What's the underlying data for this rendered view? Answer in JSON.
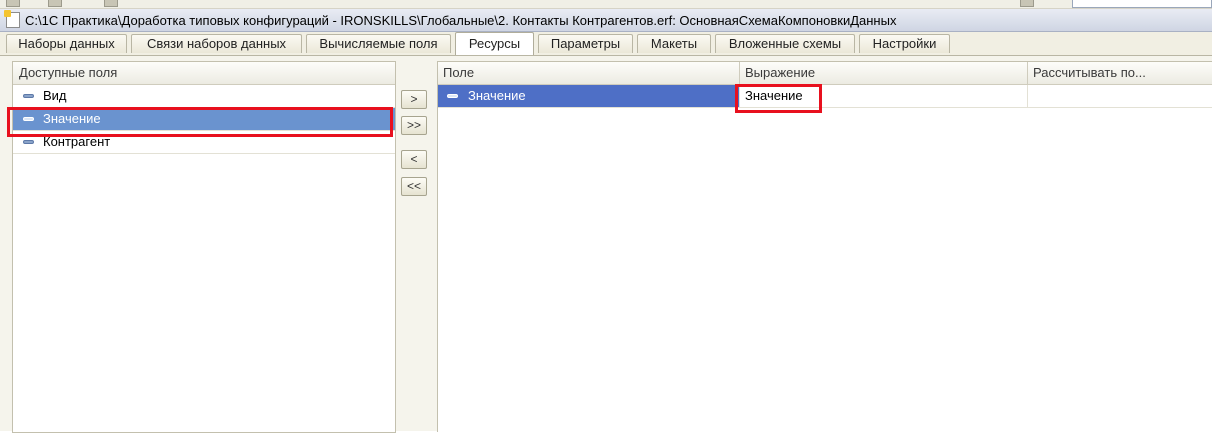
{
  "window": {
    "title": "C:\\1С Практика\\Доработка типовых конфигураций - IRONSKILLS\\Глобальные\\2. Контакты Контрагентов.erf: ОсновнаяСхемаКомпоновкиДанных"
  },
  "tabs": [
    {
      "label": "Наборы данных"
    },
    {
      "label": "Связи наборов данных"
    },
    {
      "label": "Вычисляемые поля"
    },
    {
      "label": "Ресурсы",
      "active": true
    },
    {
      "label": "Параметры"
    },
    {
      "label": "Макеты"
    },
    {
      "label": "Вложенные схемы"
    },
    {
      "label": "Настройки"
    }
  ],
  "available_fields": {
    "header": "Доступные поля",
    "items": [
      {
        "label": "Вид",
        "icon": "field-icon"
      },
      {
        "label": "Значение",
        "icon": "field-icon",
        "selected": true
      },
      {
        "label": "Контрагент",
        "icon": "field-icon"
      }
    ]
  },
  "move_buttons": {
    "add": ">",
    "add_all": ">>",
    "remove": "<",
    "remove_all": "<<"
  },
  "resources_table": {
    "columns": [
      "Поле",
      "Выражение",
      "Рассчитывать по..."
    ],
    "rows": [
      {
        "field": "Значение",
        "expression": "Значение",
        "calculate_by": ""
      }
    ]
  },
  "colors": {
    "selection": "#6a93cf",
    "row_selection": "#4e6fc6",
    "highlight_frame": "#e8101e"
  }
}
